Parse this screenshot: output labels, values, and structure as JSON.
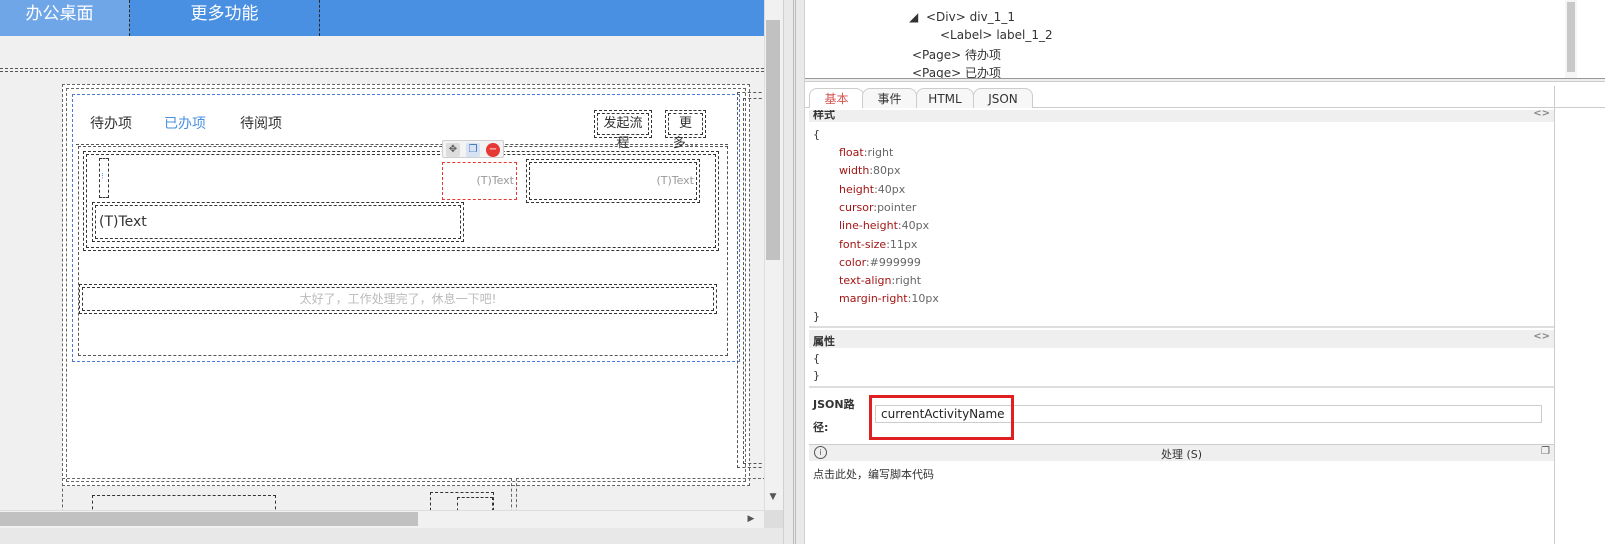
{
  "designer": {
    "nav": {
      "desk_label": "办公桌面",
      "more_label": "更多功能"
    },
    "portal": {
      "tabs": [
        "待办项",
        "已办项",
        "待阅项"
      ],
      "start_flow": "发起流程",
      "more": "更多..."
    },
    "items": {
      "text_small_1": "(T)Text",
      "text_small_2": "(T)Text",
      "text_big": "(T)Text",
      "empty_message": "太好了，工作处理完了，休息一下吧!"
    },
    "toolbar": {
      "move_icon": "move-icon",
      "copy_icon": "copy-icon",
      "delete_icon": "delete-icon"
    }
  },
  "tree": {
    "nodes": [
      {
        "tag": "<Div>",
        "name": "div_1_1",
        "expanded": true
      },
      {
        "tag": "<Label>",
        "name": "label_1_2"
      },
      {
        "tag": "<Page>",
        "name": "待办项"
      },
      {
        "tag": "<Page>",
        "name": "已办项"
      }
    ]
  },
  "props": {
    "tabs": [
      "基本",
      "事件",
      "HTML",
      "JSON"
    ],
    "style_section": {
      "title": "样式",
      "open": "{",
      "close": "}",
      "entries": [
        {
          "key": "float",
          "value": "right"
        },
        {
          "key": "width",
          "value": "80px"
        },
        {
          "key": "height",
          "value": "40px"
        },
        {
          "key": "cursor",
          "value": "pointer"
        },
        {
          "key": "line-height",
          "value": "40px"
        },
        {
          "key": "font-size",
          "value": "11px"
        },
        {
          "key": "color",
          "value": "#999999"
        },
        {
          "key": "text-align",
          "value": "right"
        },
        {
          "key": "margin-right",
          "value": "10px"
        }
      ]
    },
    "attr_section": {
      "title": "属性",
      "open": "{",
      "close": "}"
    },
    "json_path": {
      "label_1": "JSON路",
      "label_2": "径:",
      "value": "currentActivityName"
    },
    "process": {
      "title": "处理 (S)",
      "hint": "点击此处，编写脚本代码"
    }
  },
  "colors": {
    "nav_bg": "#4a90e2",
    "active_tab": "#4a90e2",
    "highlight": "#e02020",
    "style_key": "#a31515"
  }
}
